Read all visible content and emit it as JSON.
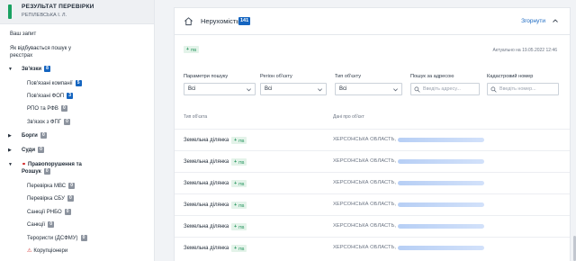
{
  "sidebar": {
    "title": "РЕЗУЛЬТАТ ПЕРЕВІРКИ",
    "subtitle": "РЕПІЛЕВСЬКА І. Л.",
    "items": [
      {
        "label": "Ваш запит"
      },
      {
        "label": "Як відбувається пошук у"
      },
      {
        "label": "реєстрах"
      },
      {
        "label": "Зв'язки",
        "badge": "8"
      },
      {
        "label": "Пов'язані компанії",
        "badge": "5"
      },
      {
        "label": "Пов'язані ФОП",
        "badge": "3"
      },
      {
        "label": "РПО та РФВ",
        "badge": "0"
      },
      {
        "label": "Зв'язок з ФПГ",
        "badge": "0"
      },
      {
        "label": "Борги",
        "badge": "0"
      },
      {
        "label": "Суди",
        "badge": "0"
      },
      {
        "label": "Правопорушення та"
      },
      {
        "label": "Розшук",
        "badge": "0"
      },
      {
        "label": "Перевірка МВС",
        "badge": "0"
      },
      {
        "label": "Перевірка СБУ",
        "badge": "0"
      },
      {
        "label": "Санкції РНБО",
        "badge": "0"
      },
      {
        "label": "Санкції",
        "badge": "0"
      },
      {
        "label": "Терористи (ДСФМУ)",
        "badge": "0"
      },
      {
        "label": "Корупціонери"
      }
    ]
  },
  "panel": {
    "title": "Нерухомість",
    "count": "141",
    "collapse_label": "Згорнути",
    "source_tag": "ПВ",
    "actual_text": "Актуально на 19.05.2022 12:46"
  },
  "filters": {
    "params": {
      "label": "Параметри пошуку",
      "value": "Всі"
    },
    "region": {
      "label": "Регіон об'єкту",
      "value": "Всі"
    },
    "type": {
      "label": "Тип об'єкту",
      "value": "Всі"
    },
    "address": {
      "label": "Пошук за адресою",
      "placeholder": "Введіть адресу..."
    },
    "cadastral": {
      "label": "Кадастровий номер",
      "placeholder": "Введіть номер..."
    }
  },
  "table": {
    "headers": [
      "Тип об'єкта",
      "Дані про об'єкт"
    ],
    "rows": [
      {
        "type": "Земельна ділянка",
        "tag": "ПВ",
        "data": "ХЕРСОНСЬКА ОБЛАСТЬ,"
      },
      {
        "type": "Земельна ділянка",
        "tag": "ПВ",
        "data": "ХЕРСОНСЬКА ОБЛАСТЬ,"
      },
      {
        "type": "Земельна ділянка",
        "tag": "ПВ",
        "data": "ХЕРСОНСЬКА ОБЛАСТЬ,"
      },
      {
        "type": "Земельна ділянка",
        "tag": "ПВ",
        "data": "ХЕРСОНСЬКА ОБЛАСТЬ,"
      },
      {
        "type": "Земельна ділянка",
        "tag": "ПВ",
        "data": "ХЕРСОНСЬКА ОБЛАСТЬ,"
      },
      {
        "type": "Земельна ділянка",
        "tag": "ПВ",
        "data": "ХЕРСОНСЬКА ОБЛАСТЬ,"
      }
    ]
  },
  "colors": {
    "accent": "#1565c0",
    "success": "#1aa262",
    "danger": "#d32f2f"
  }
}
